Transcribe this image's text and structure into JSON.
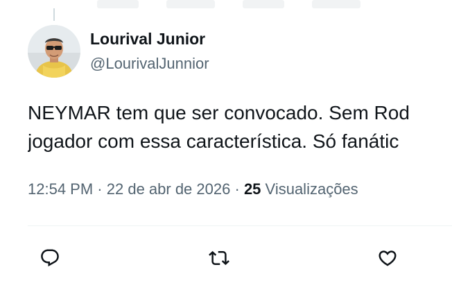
{
  "tweet": {
    "author": {
      "display_name": "Lourival Junior",
      "handle": "@LourivalJunnior"
    },
    "text_lines": [
      "NEYMAR tem que ser convocado. Sem Rod",
      "jogador com essa característica. Só fanátic"
    ],
    "time": "12:54 PM",
    "separator": "·",
    "date": "22 de abr de 2026",
    "views_count": "25",
    "views_label": "Visualizações",
    "actions": [
      "reply-icon",
      "retweet-icon",
      "like-icon"
    ]
  },
  "colors": {
    "primary_text": "#0f1419",
    "secondary_text": "#536471",
    "divider": "#eff3f4"
  }
}
